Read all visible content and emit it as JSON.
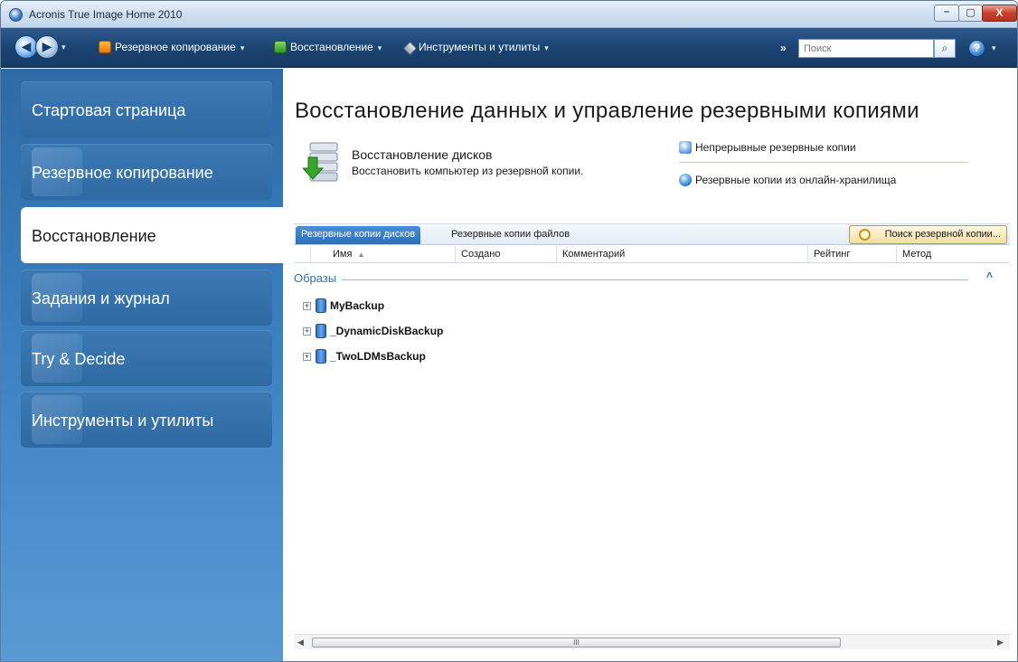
{
  "window": {
    "title": "Acronis True Image Home 2010",
    "controls": {
      "minimize": "–",
      "maximize": "▢",
      "close": "X"
    }
  },
  "toolbar": {
    "back": "◀",
    "forward": "▶",
    "dropdown_caret": "▾",
    "backup_label": "Резервное копирование",
    "restore_label": "Восстановление",
    "tools_label": "Инструменты и утилиты",
    "more_chevron": "»",
    "search_placeholder": "Поиск",
    "search_icon": "search-icon",
    "help": "?"
  },
  "sidebar": {
    "items": [
      {
        "label": "Стартовая страница",
        "active": false
      },
      {
        "label": "Резервное копирование",
        "active": false
      },
      {
        "label": "Восстановление",
        "active": true
      },
      {
        "label": "Задания и журнал",
        "active": false
      },
      {
        "label": "Try & Decide",
        "active": false
      },
      {
        "label": "Инструменты и утилиты",
        "active": false
      }
    ],
    "colors": {
      "gradient_top": "#2e6aa6",
      "gradient_bottom": "#5a9ad3",
      "active_bg": "#ffffff"
    }
  },
  "main": {
    "title": "Восстановление данных и управление резервными копиями",
    "disk_restore": {
      "title": "Восстановление дисков",
      "description": "Восстановить компьютер из резервной копии."
    },
    "links": {
      "continuous": "Непрерывные резервные копии",
      "online": "Резервные копии из онлайн-хранилища"
    },
    "tabs": [
      {
        "label": "Резервные копии дисков",
        "active": true
      },
      {
        "label": "Резервные копии файлов",
        "active": false
      }
    ],
    "search_backup_label": "Поиск резервной копии...",
    "columns": {
      "name": "Имя",
      "created": "Создано",
      "comment": "Комментарий",
      "rating": "Рейтинг",
      "method": "Метод"
    },
    "group": {
      "label": "Образы",
      "collapse": "˄"
    },
    "rows": [
      {
        "name": "MyBackup",
        "expander": "+"
      },
      {
        "name": "_DynamicDiskBackup",
        "expander": "+"
      },
      {
        "name": "_TwoLDMsBackup",
        "expander": "+"
      }
    ],
    "scrollbar": {
      "left": "◀",
      "right": "▶",
      "grip": "III"
    },
    "accent_color": "#2a6fbd"
  }
}
